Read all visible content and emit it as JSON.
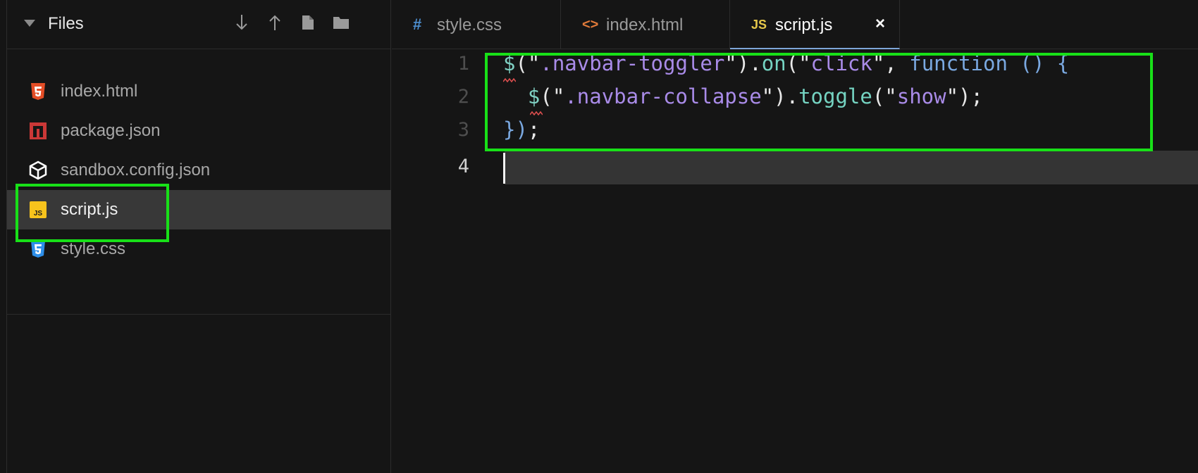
{
  "sidebar": {
    "title": "Files",
    "header_icons": [
      "arrow-down-icon",
      "arrow-up-icon",
      "new-file-icon",
      "new-folder-icon"
    ],
    "files": [
      {
        "name": "index.html",
        "icon": "html5-icon",
        "color": "#e44d26"
      },
      {
        "name": "package.json",
        "icon": "npm-icon",
        "color": "#cb3837"
      },
      {
        "name": "sandbox.config.json",
        "icon": "codesandbox-icon",
        "color": "#ffffff"
      },
      {
        "name": "script.js",
        "icon": "js-icon",
        "color": "#f7c31c",
        "active": true
      },
      {
        "name": "style.css",
        "icon": "css3-icon",
        "color": "#2d8ee8"
      }
    ]
  },
  "tabs": [
    {
      "label": "style.css",
      "icon": "#",
      "icon_color": "#4d8fd0"
    },
    {
      "label": "index.html",
      "icon": "<>",
      "icon_color": "#e07a3a"
    },
    {
      "label": "script.js",
      "icon": "JS",
      "icon_color": "#e6c84a",
      "active": true,
      "close": "×"
    }
  ],
  "editor": {
    "line_numbers": [
      "1",
      "2",
      "3",
      "4"
    ],
    "active_line": "4",
    "lines": [
      "$(\".navbar-toggler\").on(\"click\", function () {",
      "  $(\".navbar-collapse\").toggle(\"show\");",
      "});",
      ""
    ],
    "tokens": {
      "l1": [
        "$",
        "(\"",
        ".navbar-toggler",
        "\")",
        ".",
        "on",
        "(\"",
        "click",
        "\", ",
        "function",
        " () {"
      ],
      "l2": [
        "$",
        "(\"",
        ".navbar-collapse",
        "\")",
        ".",
        "toggle",
        "(\"",
        "show",
        "\");"
      ],
      "l3": [
        "})",
        ";"
      ]
    }
  },
  "colors": {
    "highlight": "#18e018",
    "background": "#151515",
    "active_row": "#383838"
  }
}
